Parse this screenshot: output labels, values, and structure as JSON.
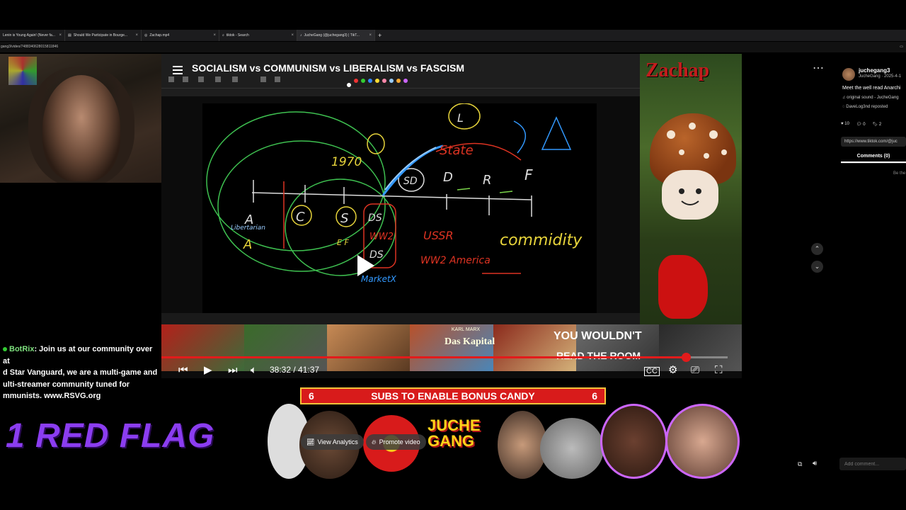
{
  "browser": {
    "tabs": [
      {
        "label": "Lenin is Young Again! (Never fa...",
        "active": false
      },
      {
        "label": "Should We Participate in Bourge...",
        "active": false
      },
      {
        "label": "Zachap.mp4",
        "active": false
      },
      {
        "label": "tiktok - Search",
        "active": false
      },
      {
        "label": "JucheGang (@juchegang3) | TikT...",
        "active": true
      }
    ],
    "new_tab": "+",
    "url": "gang3/video/7488340628015811846"
  },
  "video": {
    "title": "SOCIALISM vs COMMUNISM vs LIBERALISM vs FASCISM",
    "timecode": "38:32 / 41:37",
    "progress": 0.926,
    "drawing_text": {
      "t1970": "1970",
      "libertarian": "Libertarian",
      "a1": "A",
      "a2": "A",
      "c": "C",
      "s": "S",
      "sd": "SD",
      "d": "D",
      "r": "R",
      "f": "F",
      "l": "L",
      "state": "State",
      "ussr": "USSR",
      "ww2": "WW2 America",
      "commodity": "commidity",
      "ds1": "DS",
      "ww2b": "WW2",
      "ds2": "DS",
      "market": "MarketX",
      "ef": "E F"
    }
  },
  "overlay": {
    "zachap": "Zachap",
    "chat_user": "BotRix",
    "chat_message": ": Join us at our community over at Red Star Vanguard, we are a multi-game and multi-streamer community tuned for communists. www.RSVG.org",
    "chat_line1_tail": ": Join us at our community over at",
    "chat_line2": "d Star Vanguard, we are a multi-game and",
    "chat_line3": "ulti-streamer community tuned for",
    "chat_line4": "mmunists. www.RSVG.org",
    "red_flag": "1 RED FLAG",
    "banner_left": "6",
    "banner_text": "SUBS TO ENABLE BONUS CANDY",
    "banner_right": "6",
    "juche_gang_line1": "JUCHE",
    "juche_gang_line2": "GANG",
    "you_wouldnt": "YOU WOULDN'T",
    "read_the_room": "READ THE ROOM",
    "das_kapital": "Das Kapital",
    "karl_marx": "KARL MARX"
  },
  "tiktok": {
    "username": "juchegang3",
    "subline": "JucheGang · 2025-4-1",
    "description": "Meet the well read Anarchi",
    "sound": "♫ original sound - JucheGang",
    "repost": "DaveLog3nd reposted",
    "likes": "10",
    "comments_count": "0",
    "saves": "2",
    "link": "https://www.tiktok.com/@juc",
    "comments_tab": "Comments (0)",
    "first_comment_hint": "Be the",
    "comment_placeholder": "Add comment...",
    "view_analytics": "View Analytics",
    "promote_video": "Promote video"
  },
  "colors": {
    "accent_red": "#e21b1b",
    "banner_border": "#ffc43a",
    "red_flag_purple": "#8b3df0",
    "chat_user_green": "#7ee07e"
  },
  "icons": {
    "menu": "hamburger-icon",
    "play": "play-icon",
    "prev": "skip-previous-icon",
    "next": "skip-next-icon",
    "volume": "volume-icon",
    "cc": "captions-icon",
    "settings": "gear-icon",
    "cast": "cast-icon",
    "fullscreen": "fullscreen-icon"
  }
}
